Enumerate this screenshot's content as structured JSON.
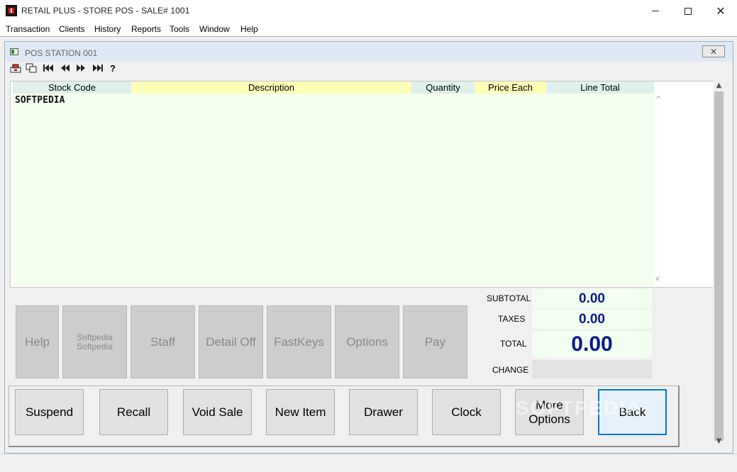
{
  "window": {
    "title": "RETAIL PLUS  -  STORE POS  -  SALE# 1001",
    "minimize_icon": "minimize-icon",
    "maximize_icon": "maximize-icon",
    "close_icon": "close-icon"
  },
  "menu": {
    "items": [
      "Transaction",
      "Clients",
      "History",
      "Reports",
      "Tools",
      "Window",
      "Help"
    ]
  },
  "child_window": {
    "title": "POS STATION 001",
    "close_label": "✕"
  },
  "toolbar": {
    "icons": [
      "open-drawer-icon",
      "copy-window-icon",
      "first-record-icon",
      "previous-record-icon",
      "next-record-icon",
      "last-record-icon",
      "help-icon"
    ],
    "help_label": "?"
  },
  "grid": {
    "columns": [
      "Stock Code",
      "Description",
      "Quantity",
      "Price Each",
      "Line Total"
    ],
    "rows": [
      {
        "stock_code": "SOFTPEDIA"
      }
    ],
    "header_colors": {
      "teal": "#e0f1ec",
      "yellow": "#ffffb8"
    }
  },
  "totals": {
    "subtotal_label": "SUBTOTAL",
    "subtotal_value": "0.00",
    "taxes_label": "TAXES",
    "taxes_value": "0.00",
    "total_label": "TOTAL",
    "total_value": "0.00",
    "change_label": "CHANGE",
    "change_value": ""
  },
  "function_buttons": {
    "help": "Help",
    "softpedia_line1": "Softpedia",
    "softpedia_line2": "Softpedia",
    "staff": "Staff",
    "detail_off": "Detail Off",
    "fastkeys": "FastKeys",
    "options": "Options",
    "pay": "Pay"
  },
  "action_buttons": {
    "suspend": "Suspend",
    "recall": "Recall",
    "void_sale": "Void Sale",
    "new_item": "New Item",
    "drawer": "Drawer",
    "clock": "Clock",
    "more_options_line1": "More",
    "more_options_line2": "Options",
    "back": "Back"
  },
  "watermark": "SOFTPEDIA",
  "colors": {
    "total_text": "#0a1a8a",
    "focus_border": "#0078d7",
    "disabled_button": "#cdcdcd"
  }
}
